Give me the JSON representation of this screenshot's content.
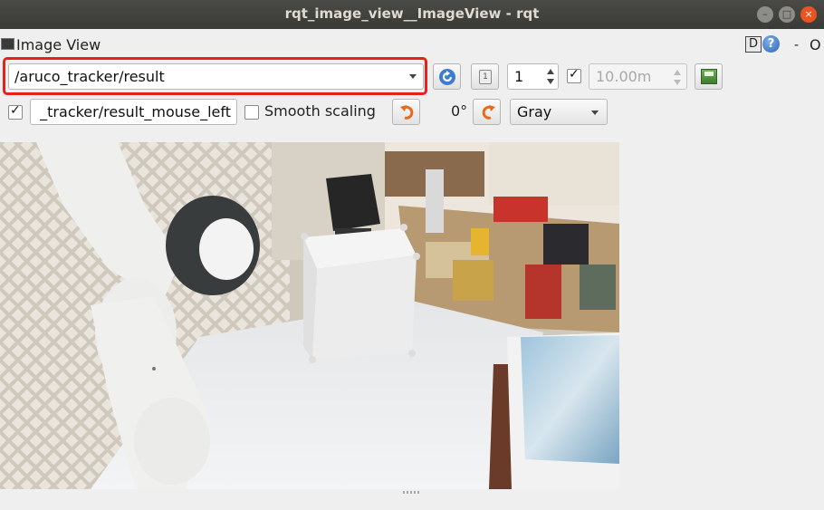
{
  "window": {
    "title": "rqt_image_view__ImageView - rqt",
    "controls": {
      "minimize_icon": "minimize-icon",
      "maximize_icon": "maximize-icon",
      "close_icon": "close-icon"
    }
  },
  "dock": {
    "title": "Image View",
    "help_d": "D",
    "help_q": "?",
    "dash": "-",
    "o": "O"
  },
  "toolbar": {
    "topic": "/aruco_tracker/result",
    "zoom_value": "1",
    "rate_enabled": true,
    "rate_value": "10.00m",
    "mouse_publish_enabled": true,
    "mouse_topic": "_tracker/result_mouse_left",
    "smooth_scaling_label": "Smooth scaling",
    "smooth_scaling_checked": false,
    "rotation_label": "0°",
    "color_scheme": "Gray"
  },
  "highlight_color": "#e8201b",
  "image": {
    "description_icon": "camera-image",
    "alt": "robot arm, white cube, cluttered desk"
  }
}
